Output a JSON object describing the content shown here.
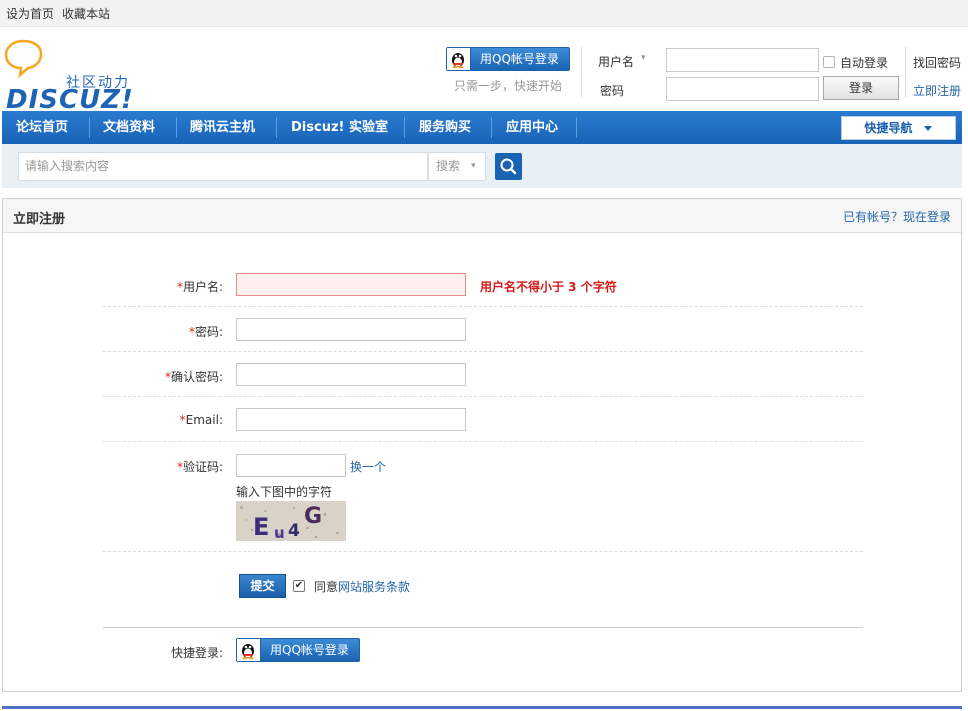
{
  "topbar": {
    "set_home": "设为首页",
    "favorite": "收藏本站"
  },
  "header": {
    "logo_slogan": "社区动力",
    "logo_word": "DISCUZ!",
    "qq_login": "用QQ帐号登录",
    "qq_sub": "只需一步，快速开始",
    "username_label": "用户名",
    "username_arrow": "▾",
    "password_label": "密码",
    "auto_login": "自动登录",
    "login_button": "登录",
    "find_password": "找回密码",
    "register": "立即注册"
  },
  "nav": {
    "items": [
      "论坛首页",
      "文档资料",
      "腾讯云主机",
      "Discuz! 实验室",
      "服务购买",
      "应用中心"
    ],
    "quick_nav": "快捷导航"
  },
  "search": {
    "placeholder": "请输入搜索内容",
    "type": "搜索",
    "caret": "▾"
  },
  "register": {
    "title": "立即注册",
    "login_link": "已有帐号？现在登录",
    "required_mark": "*",
    "fields": {
      "username": "用户名:",
      "password": "密码:",
      "confirm": "确认密码:",
      "email": "Email:",
      "captcha": "验证码:"
    },
    "username_error": "用户名不得小于 3 个字符",
    "captcha_swap": "换一个",
    "captcha_tip": "输入下图中的字符",
    "captcha_text": "Eu4G",
    "submit": "提交",
    "agree_prefix": "同意",
    "agree_link": "网站服务条款",
    "agree_checked": "✔",
    "quick_login_label": "快捷登录:",
    "qq_login": "用QQ帐号登录"
  },
  "colors": {
    "brand_blue": "#1a63b2",
    "error_red": "#d61a1a",
    "link_blue": "#2366a8"
  }
}
